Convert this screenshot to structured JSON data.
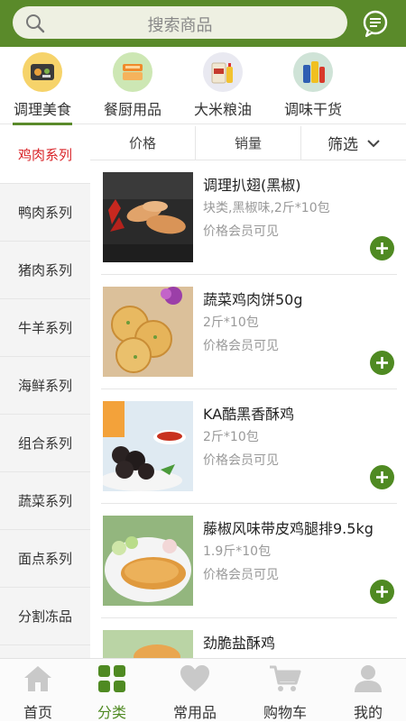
{
  "search": {
    "placeholder": "搜索商品"
  },
  "categories": [
    {
      "label": "调理美食",
      "icon": "prepared-food-icon",
      "active": true
    },
    {
      "label": "餐厨用品",
      "icon": "kitchenware-icon"
    },
    {
      "label": "大米粮油",
      "icon": "rice-oil-icon"
    },
    {
      "label": "调味干货",
      "icon": "seasoning-icon"
    }
  ],
  "sidebar": {
    "items": [
      {
        "label": "鸡肉系列"
      },
      {
        "label": "鸭肉系列"
      },
      {
        "label": "猪肉系列"
      },
      {
        "label": "牛羊系列"
      },
      {
        "label": "海鲜系列"
      },
      {
        "label": "组合系列"
      },
      {
        "label": "蔬菜系列"
      },
      {
        "label": "面点系列"
      },
      {
        "label": "分割冻品"
      }
    ]
  },
  "sort": {
    "price": "价格",
    "sales": "销量",
    "filter": "筛选"
  },
  "products": [
    {
      "name": "调理扒翅(黑椒)",
      "spec": "块类,黑椒味,2斤*10包",
      "price_note": "价格会员可见"
    },
    {
      "name": "蔬菜鸡肉饼50g",
      "spec": "2斤*10包",
      "price_note": "价格会员可见"
    },
    {
      "name": "KA酷黑香酥鸡",
      "spec": "2斤*10包",
      "price_note": "价格会员可见"
    },
    {
      "name": "藤椒风味带皮鸡腿排9.5kg",
      "spec": "1.9斤*10包",
      "price_note": "价格会员可见"
    },
    {
      "name": "劲脆盐酥鸡",
      "spec": "",
      "price_note": ""
    }
  ],
  "bottom_nav": [
    {
      "label": "首页",
      "icon": "home-icon"
    },
    {
      "label": "分类",
      "icon": "category-grid-icon",
      "active": true
    },
    {
      "label": "常用品",
      "icon": "heart-icon"
    },
    {
      "label": "购物车",
      "icon": "cart-icon"
    },
    {
      "label": "我的",
      "icon": "user-icon"
    }
  ],
  "colors": {
    "brand": "#5a8a2a",
    "accent_red": "#d9252a",
    "add_button": "#4f8a22"
  }
}
